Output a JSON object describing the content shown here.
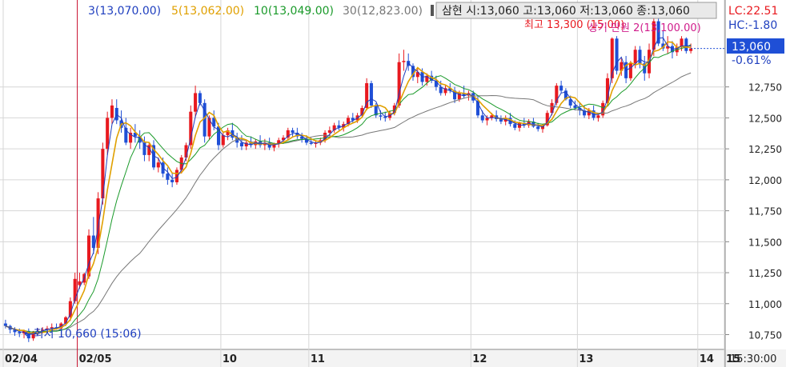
{
  "legend": {
    "items": [
      {
        "label": "3",
        "value": "(13,070.00)",
        "color": "#1f3fbf"
      },
      {
        "label": "5",
        "value": "(13,062.00)",
        "color": "#e0a000"
      },
      {
        "label": "10",
        "value": "(13,049.00)",
        "color": "#1a9a2a"
      },
      {
        "label": "30",
        "value": "(12,823.00)",
        "color": "#777777"
      }
    ]
  },
  "quote_box": {
    "text": "삼현 시:13,060 고:13,060 저:13,060 종:13,060"
  },
  "right_panel": {
    "lc": "LC:22.51",
    "hc": "HC:-1.80",
    "price": "13,060",
    "change": "-0.61%",
    "time": "15:30:00"
  },
  "annotations": {
    "high": "최고 13,300 (15:00)",
    "overlap": "상기 만원 2(13,100.00)",
    "low": "←최저 10,660 (15:06)"
  },
  "colors": {
    "up": "#e8191f",
    "down": "#1f4fd6",
    "ma3": "#1f3fbf",
    "ma5": "#e0a000",
    "ma10": "#1a9a2a",
    "ma30": "#777777",
    "grid": "#d6d6d6",
    "axis_bg": "#f3f3f3",
    "price_box": "#1f4fd6"
  },
  "chart_data": {
    "type": "candlestick",
    "x_labels": [
      "02/04",
      "02/05",
      "10",
      "11",
      "12",
      "13",
      "14",
      "15"
    ],
    "ylim": [
      10650,
      13400
    ],
    "y_ticks": [
      10750,
      11000,
      11250,
      11500,
      11750,
      12000,
      12250,
      12500,
      12750
    ],
    "y_tick_labels": [
      "10,750",
      "11,000",
      "11,250",
      "11,500",
      "11,750",
      "12,000",
      "12,250",
      "12,500",
      "12,750"
    ],
    "candles": [
      [
        10840,
        10870,
        10800,
        10820
      ],
      [
        10820,
        10830,
        10760,
        10790
      ],
      [
        10790,
        10810,
        10740,
        10770
      ],
      [
        10770,
        10800,
        10730,
        10760
      ],
      [
        10760,
        10790,
        10720,
        10780
      ],
      [
        10780,
        10800,
        10690,
        10720
      ],
      [
        10720,
        10780,
        10700,
        10770
      ],
      [
        10770,
        10800,
        10750,
        10780
      ],
      [
        10780,
        10810,
        10760,
        10790
      ],
      [
        10790,
        10820,
        10760,
        10800
      ],
      [
        10800,
        10840,
        10780,
        10810
      ],
      [
        10810,
        10840,
        10790,
        10800
      ],
      [
        10800,
        10850,
        10790,
        10840
      ],
      [
        10840,
        10900,
        10820,
        10890
      ],
      [
        10890,
        11050,
        10860,
        11020
      ],
      [
        11020,
        11250,
        11000,
        11200
      ],
      [
        11150,
        11250,
        11120,
        11180
      ],
      [
        11170,
        11250,
        11150,
        11240
      ],
      [
        11220,
        11600,
        11200,
        11550
      ],
      [
        11550,
        11700,
        11400,
        11450
      ],
      [
        11450,
        11900,
        11400,
        11850
      ],
      [
        11850,
        12300,
        11800,
        12250
      ],
      [
        12250,
        12550,
        12200,
        12500
      ],
      [
        12500,
        12650,
        12450,
        12600
      ],
      [
        12580,
        12650,
        12450,
        12480
      ],
      [
        12480,
        12560,
        12380,
        12420
      ],
      [
        12420,
        12500,
        12280,
        12300
      ],
      [
        12300,
        12420,
        12250,
        12380
      ],
      [
        12380,
        12450,
        12300,
        12350
      ],
      [
        12350,
        12400,
        12250,
        12300
      ],
      [
        12300,
        12350,
        12150,
        12200
      ],
      [
        12200,
        12300,
        12150,
        12280
      ],
      [
        12280,
        12320,
        12080,
        12100
      ],
      [
        12100,
        12180,
        12060,
        12140
      ],
      [
        12140,
        12180,
        12020,
        12050
      ],
      [
        12050,
        12100,
        11960,
        12000
      ],
      [
        12000,
        12050,
        11940,
        11980
      ],
      [
        11980,
        12100,
        11960,
        12080
      ],
      [
        12080,
        12200,
        12050,
        12180
      ],
      [
        12180,
        12300,
        12150,
        12280
      ],
      [
        12280,
        12600,
        12250,
        12550
      ],
      [
        12550,
        12760,
        12500,
        12700
      ],
      [
        12700,
        12720,
        12600,
        12620
      ],
      [
        12620,
        12650,
        12300,
        12350
      ],
      [
        12350,
        12520,
        12320,
        12500
      ],
      [
        12500,
        12560,
        12400,
        12430
      ],
      [
        12430,
        12460,
        12240,
        12280
      ],
      [
        12280,
        12380,
        12260,
        12360
      ],
      [
        12360,
        12420,
        12320,
        12400
      ],
      [
        12400,
        12460,
        12320,
        12340
      ],
      [
        12340,
        12380,
        12260,
        12300
      ],
      [
        12300,
        12360,
        12240,
        12270
      ],
      [
        12270,
        12320,
        12240,
        12300
      ],
      [
        12300,
        12350,
        12260,
        12280
      ],
      [
        12280,
        12330,
        12250,
        12310
      ],
      [
        12310,
        12360,
        12260,
        12280
      ],
      [
        12280,
        12330,
        12240,
        12300
      ],
      [
        12300,
        12340,
        12240,
        12260
      ],
      [
        12260,
        12300,
        12230,
        12290
      ],
      [
        12290,
        12340,
        12260,
        12320
      ],
      [
        12320,
        12360,
        12290,
        12340
      ],
      [
        12340,
        12420,
        12320,
        12400
      ],
      [
        12400,
        12420,
        12350,
        12380
      ],
      [
        12380,
        12420,
        12330,
        12350
      ],
      [
        12350,
        12380,
        12300,
        12330
      ],
      [
        12330,
        12360,
        12280,
        12300
      ],
      [
        12300,
        12340,
        12280,
        12290
      ],
      [
        12290,
        12320,
        12260,
        12300
      ],
      [
        12300,
        12340,
        12280,
        12320
      ],
      [
        12320,
        12400,
        12300,
        12380
      ],
      [
        12380,
        12430,
        12350,
        12400
      ],
      [
        12400,
        12460,
        12380,
        12440
      ],
      [
        12440,
        12480,
        12400,
        12420
      ],
      [
        12420,
        12470,
        12390,
        12450
      ],
      [
        12450,
        12520,
        12430,
        12500
      ],
      [
        12500,
        12540,
        12460,
        12480
      ],
      [
        12480,
        12540,
        12460,
        12520
      ],
      [
        12520,
        12600,
        12500,
        12580
      ],
      [
        12580,
        12820,
        12560,
        12780
      ],
      [
        12780,
        12800,
        12580,
        12600
      ],
      [
        12600,
        12620,
        12500,
        12520
      ],
      [
        12520,
        12560,
        12480,
        12510
      ],
      [
        12510,
        12550,
        12470,
        12500
      ],
      [
        12500,
        12560,
        12480,
        12540
      ],
      [
        12540,
        12620,
        12520,
        12600
      ],
      [
        12600,
        13020,
        12580,
        12950
      ],
      [
        12950,
        13050,
        12880,
        12960
      ],
      [
        12960,
        13020,
        12880,
        12920
      ],
      [
        12920,
        12940,
        12800,
        12830
      ],
      [
        12830,
        12900,
        12780,
        12870
      ],
      [
        12870,
        12900,
        12760,
        12790
      ],
      [
        12790,
        12860,
        12760,
        12840
      ],
      [
        12840,
        12880,
        12780,
        12800
      ],
      [
        12800,
        12840,
        12720,
        12750
      ],
      [
        12750,
        12800,
        12680,
        12700
      ],
      [
        12700,
        12760,
        12680,
        12740
      ],
      [
        12740,
        12780,
        12700,
        12720
      ],
      [
        12720,
        12750,
        12620,
        12650
      ],
      [
        12650,
        12720,
        12630,
        12700
      ],
      [
        12700,
        12760,
        12660,
        12680
      ],
      [
        12680,
        12720,
        12640,
        12700
      ],
      [
        12700,
        12720,
        12620,
        12640
      ],
      [
        12640,
        12680,
        12500,
        12520
      ],
      [
        12520,
        12560,
        12460,
        12480
      ],
      [
        12480,
        12520,
        12440,
        12500
      ],
      [
        12500,
        12540,
        12480,
        12520
      ],
      [
        12520,
        12560,
        12470,
        12490
      ],
      [
        12490,
        12520,
        12450,
        12470
      ],
      [
        12470,
        12520,
        12440,
        12500
      ],
      [
        12500,
        12540,
        12430,
        12450
      ],
      [
        12450,
        12480,
        12400,
        12420
      ],
      [
        12420,
        12470,
        12390,
        12460
      ],
      [
        12460,
        12500,
        12420,
        12440
      ],
      [
        12440,
        12490,
        12420,
        12470
      ],
      [
        12470,
        12500,
        12420,
        12430
      ],
      [
        12430,
        12460,
        12390,
        12410
      ],
      [
        12410,
        12450,
        12380,
        12440
      ],
      [
        12440,
        12560,
        12430,
        12540
      ],
      [
        12540,
        12650,
        12520,
        12620
      ],
      [
        12620,
        12780,
        12600,
        12760
      ],
      [
        12760,
        12800,
        12700,
        12720
      ],
      [
        12720,
        12740,
        12640,
        12650
      ],
      [
        12650,
        12680,
        12580,
        12600
      ],
      [
        12600,
        12640,
        12560,
        12580
      ],
      [
        12580,
        12620,
        12520,
        12560
      ],
      [
        12560,
        12600,
        12500,
        12520
      ],
      [
        12520,
        12580,
        12490,
        12560
      ],
      [
        12560,
        12600,
        12480,
        12500
      ],
      [
        12500,
        12540,
        12470,
        12520
      ],
      [
        12520,
        12640,
        12500,
        12620
      ],
      [
        12620,
        12860,
        12600,
        12820
      ],
      [
        12820,
        13150,
        12780,
        13140
      ],
      [
        13140,
        13160,
        12850,
        12880
      ],
      [
        12880,
        12980,
        12840,
        12950
      ],
      [
        12950,
        13000,
        12780,
        12820
      ],
      [
        12820,
        12960,
        12800,
        12940
      ],
      [
        12940,
        13080,
        12900,
        13050
      ],
      [
        13050,
        13080,
        12900,
        12940
      ],
      [
        12940,
        13000,
        12800,
        12860
      ],
      [
        12860,
        13100,
        12820,
        13050
      ],
      [
        13050,
        13300,
        13000,
        13280
      ],
      [
        13280,
        13300,
        13080,
        13100
      ],
      [
        13100,
        13200,
        13040,
        13060
      ],
      [
        13060,
        13160,
        13020,
        13080
      ],
      [
        13080,
        13120,
        12980,
        13030
      ],
      [
        13030,
        13100,
        13000,
        13070
      ],
      [
        13070,
        13160,
        13040,
        13140
      ],
      [
        13140,
        13150,
        13020,
        13040
      ],
      [
        13040,
        13100,
        13020,
        13060
      ]
    ]
  }
}
